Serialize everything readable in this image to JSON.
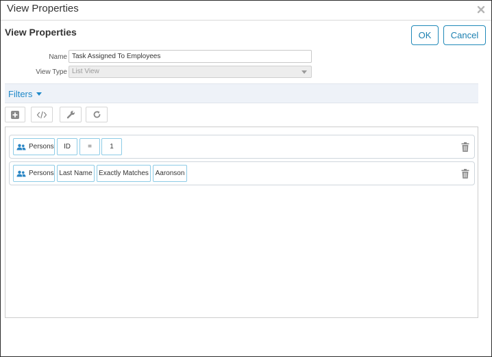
{
  "window": {
    "title": "View Properties"
  },
  "header": {
    "title": "View Properties",
    "ok_label": "OK",
    "cancel_label": "Cancel"
  },
  "form": {
    "name_label": "Name",
    "name_value": "Task Assigned To Employees",
    "view_type_label": "View Type",
    "view_type_value": "List View"
  },
  "filters": {
    "label": "Filters",
    "toolbar": [
      "add-icon",
      "code-icon",
      "wrench-icon",
      "refresh-icon"
    ],
    "rows": [
      {
        "entity": "Persons",
        "field": "ID",
        "operator": "=",
        "value": "1"
      },
      {
        "entity": "Persons",
        "field": "Last Name",
        "operator": "Exactly Matches",
        "value": "Aaronson"
      }
    ]
  },
  "colors": {
    "accent": "#1e88c8",
    "chip_border": "#8ccbe6",
    "icon_gray": "#8a8a8a"
  }
}
